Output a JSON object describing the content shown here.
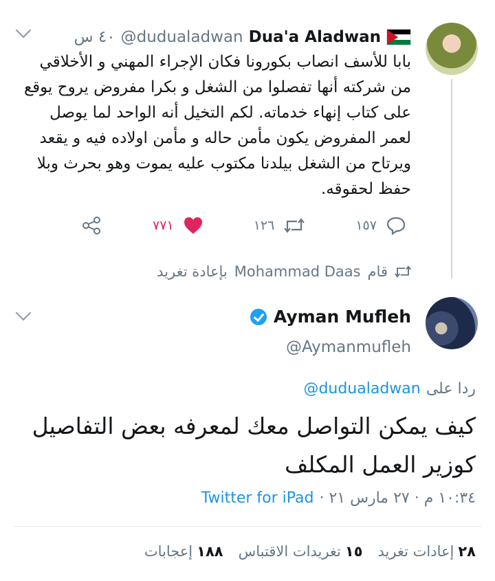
{
  "tweet1": {
    "display_name": "Dua'a Aladwan",
    "handle": "@dudualadwan",
    "time": "٤٠ س",
    "text": "بابا للأسف انصاب بكورونا فكان الإجراء المهني و الأخلاقي من شركته أنها تفصلوا من الشغل و بكرا مفروض يروح يوقع على كتاب إنهاء خدماته. لكم التخيل أنه الواحد لما يوصل لعمر المفروض يكون مأمن حاله و مأمن اولاده فيه و يقعد ويرتاح من الشغل بيلدنا مكتوب عليه يموت وهو بحرث وبلا حفظ لحقوقه.",
    "replies": "١٥٧",
    "retweets": "١٢٦",
    "likes": "٧٧١",
    "icons": {
      "reply": "reply-icon",
      "retweet": "retweet-icon",
      "like": "heart-icon",
      "share": "share-icon"
    }
  },
  "retweet_notice": {
    "prefix": "قام",
    "user": "Mohammad Daas",
    "suffix": "بإعادة تغريد"
  },
  "tweet2": {
    "display_name": "Ayman Mufleh",
    "handle": "@Aymanmufleh",
    "reply_prefix": "ردا على",
    "reply_to": "@dudualadwan",
    "text": "كيف يمكن التواصل معك لمعرفه بعض التفاصيل كوزير العمل المكلف",
    "timestamp": "١٠:٣٤ م · ٢٧ مارس ٢١ ·",
    "client": "Twitter for iPad",
    "stats": {
      "retweets_count": "٢٨",
      "retweets_label": "إعادات تغريد",
      "quotes_count": "١٥",
      "quotes_label": "تغريدات الاقتباس",
      "likes_count": "١٨٨",
      "likes_label": "إعجابات"
    }
  },
  "colors": {
    "accent": "#1b95e0",
    "like": "#e0245e",
    "muted": "#657786",
    "verified": "#1da1f2"
  }
}
